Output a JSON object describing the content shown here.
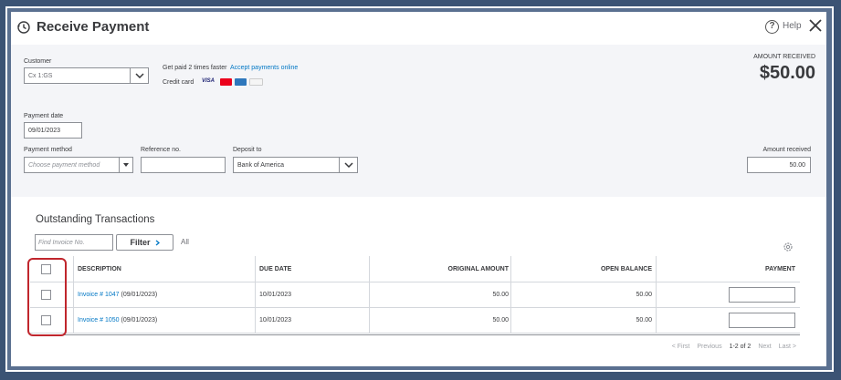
{
  "header": {
    "title": "Receive Payment",
    "help_label": "Help"
  },
  "customer": {
    "label": "Customer",
    "value": "Cx 1:GS"
  },
  "promo": {
    "text": "Get paid 2 times faster",
    "link": "Accept payments online",
    "credit_card_label": "Credit card",
    "visa_label": "VISA"
  },
  "amount_received_header": {
    "label": "AMOUNT RECEIVED",
    "value": "$50.00"
  },
  "payment_date": {
    "label": "Payment date",
    "value": "09/01/2023"
  },
  "payment_method": {
    "label": "Payment method",
    "placeholder": "Choose payment method"
  },
  "reference": {
    "label": "Reference no.",
    "value": ""
  },
  "deposit_to": {
    "label": "Deposit to",
    "value": "Bank of America"
  },
  "amount_received": {
    "label": "Amount received",
    "value": "50.00"
  },
  "outstanding": {
    "title": "Outstanding Transactions",
    "find_placeholder": "Find Invoice No.",
    "filter_label": "Filter",
    "all_label": "All",
    "columns": [
      "DESCRIPTION",
      "DUE DATE",
      "ORIGINAL AMOUNT",
      "OPEN BALANCE",
      "PAYMENT"
    ],
    "rows": [
      {
        "invoice_link": "Invoice # 1047",
        "invoice_date": "(09/01/2023)",
        "due_date": "10/01/2023",
        "original_amount": "50.00",
        "open_balance": "50.00"
      },
      {
        "invoice_link": "Invoice # 1050",
        "invoice_date": "(09/01/2023)",
        "due_date": "10/01/2023",
        "original_amount": "50.00",
        "open_balance": "50.00"
      }
    ]
  },
  "pagination": {
    "first": "< First",
    "previous": "Previous",
    "range": "1-2 of 2",
    "next": "Next",
    "last": "Last >"
  },
  "colors": {
    "link": "#0077c5",
    "highlight": "#c0262d",
    "form_bg": "#f4f5f8",
    "outer_bg": "#3b5374"
  }
}
